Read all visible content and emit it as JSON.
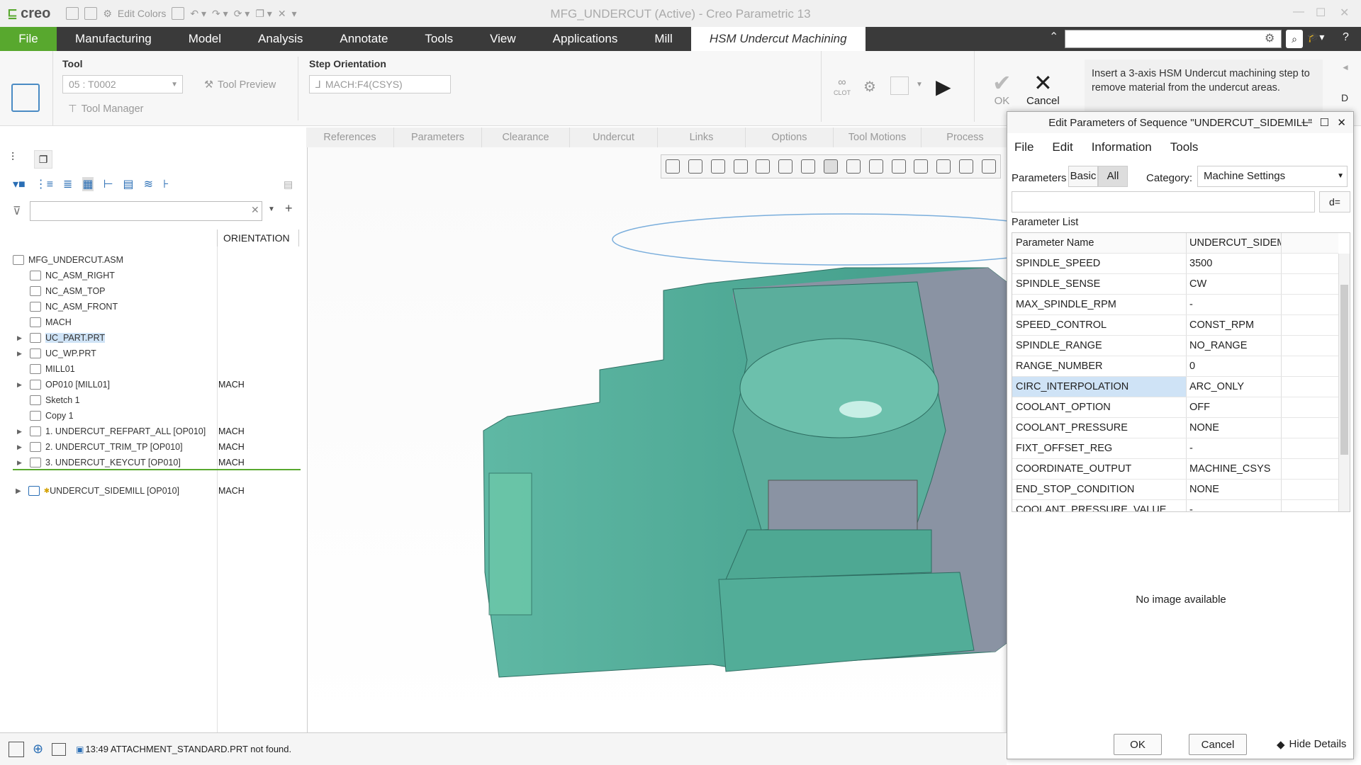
{
  "app": {
    "logo": "creo",
    "window_title": "MFG_UNDERCUT (Active) - Creo Parametric 13",
    "edit_colors": "Edit Colors"
  },
  "menubar": {
    "items": [
      "File",
      "Manufacturing",
      "Model",
      "Analysis",
      "Annotate",
      "Tools",
      "View",
      "Applications",
      "Mill"
    ],
    "active_tab": "HSM Undercut Machining",
    "accent": "#58a82e"
  },
  "ribbon": {
    "tool_group": "Tool",
    "tool_select": "05 : T0002",
    "tool_preview": "Tool Preview",
    "tool_manager": "Tool Manager",
    "step_orientation_group": "Step Orientation",
    "step_orientation_value": "MACH:F4(CSYS)",
    "clot": "CLOT",
    "ok": "OK",
    "cancel": "Cancel",
    "help_text": "Insert a 3-axis HSM Undercut machining step to remove material from the undercut areas."
  },
  "subtabs": [
    "References",
    "Parameters",
    "Clearance",
    "Undercut",
    "Links",
    "Options",
    "Tool Motions",
    "Process"
  ],
  "tree": {
    "column_header": "ORIENTATION",
    "items": [
      {
        "label": "MFG_UNDERCUT.ASM",
        "orient": "",
        "indent": 0,
        "expand": false
      },
      {
        "label": "NC_ASM_RIGHT",
        "orient": "",
        "indent": 1,
        "expand": false
      },
      {
        "label": "NC_ASM_TOP",
        "orient": "",
        "indent": 1,
        "expand": false
      },
      {
        "label": "NC_ASM_FRONT",
        "orient": "",
        "indent": 1,
        "expand": false
      },
      {
        "label": "MACH",
        "orient": "",
        "indent": 1,
        "expand": false
      },
      {
        "label": "UC_PART.PRT",
        "orient": "",
        "indent": 1,
        "expand": true
      },
      {
        "label": "UC_WP.PRT",
        "orient": "",
        "indent": 1,
        "expand": true
      },
      {
        "label": "MILL01",
        "orient": "",
        "indent": 1,
        "expand": false
      },
      {
        "label": "OP010 [MILL01]",
        "orient": "MACH",
        "indent": 1,
        "expand": true
      },
      {
        "label": "Sketch 1",
        "orient": "",
        "indent": 1,
        "expand": false
      },
      {
        "label": "Copy 1",
        "orient": "",
        "indent": 1,
        "expand": false
      },
      {
        "label": "1. UNDERCUT_REFPART_ALL [OP010]",
        "orient": "MACH",
        "indent": 1,
        "expand": true
      },
      {
        "label": "2. UNDERCUT_TRIM_TP [OP010]",
        "orient": "MACH",
        "indent": 1,
        "expand": true
      },
      {
        "label": "3. UNDERCUT_KEYCUT [OP010]",
        "orient": "MACH",
        "indent": 1,
        "expand": true
      }
    ],
    "inserted_item": {
      "label": "UNDERCUT_SIDEMILL [OP010]",
      "orient": "MACH"
    }
  },
  "dialog": {
    "title": "Edit Parameters of Sequence \"UNDERCUT_SIDEMILL\"",
    "menu": [
      "File",
      "Edit",
      "Information",
      "Tools"
    ],
    "parameters_label": "Parameters",
    "basic": "Basic",
    "all": "All",
    "category_label": "Category:",
    "category_value": "Machine Settings",
    "parameter_list_label": "Parameter List",
    "col_name": "Parameter Name",
    "col_value": "UNDERCUT_SIDEM",
    "rows": [
      {
        "name": "SPINDLE_SPEED",
        "value": "3500"
      },
      {
        "name": "SPINDLE_SENSE",
        "value": "CW"
      },
      {
        "name": "MAX_SPINDLE_RPM",
        "value": "-"
      },
      {
        "name": "SPEED_CONTROL",
        "value": "CONST_RPM"
      },
      {
        "name": "SPINDLE_RANGE",
        "value": "NO_RANGE"
      },
      {
        "name": "RANGE_NUMBER",
        "value": "0"
      },
      {
        "name": "CIRC_INTERPOLATION",
        "value": "ARC_ONLY"
      },
      {
        "name": "COOLANT_OPTION",
        "value": "OFF"
      },
      {
        "name": "COOLANT_PRESSURE",
        "value": "NONE"
      },
      {
        "name": "FIXT_OFFSET_REG",
        "value": "-"
      },
      {
        "name": "COORDINATE_OUTPUT",
        "value": "MACHINE_CSYS"
      },
      {
        "name": "END_STOP_CONDITION",
        "value": "NONE"
      },
      {
        "name": "COOLANT_PRESSURE_VALUE",
        "value": "-"
      }
    ],
    "selected_row": "CIRC_INTERPOLATION",
    "no_image": "No image available",
    "ok": "OK",
    "cancel": "Cancel",
    "hide_details": "Hide Details"
  },
  "status": {
    "message": "13:49 ATTACHMENT_STANDARD.PRT not found."
  }
}
